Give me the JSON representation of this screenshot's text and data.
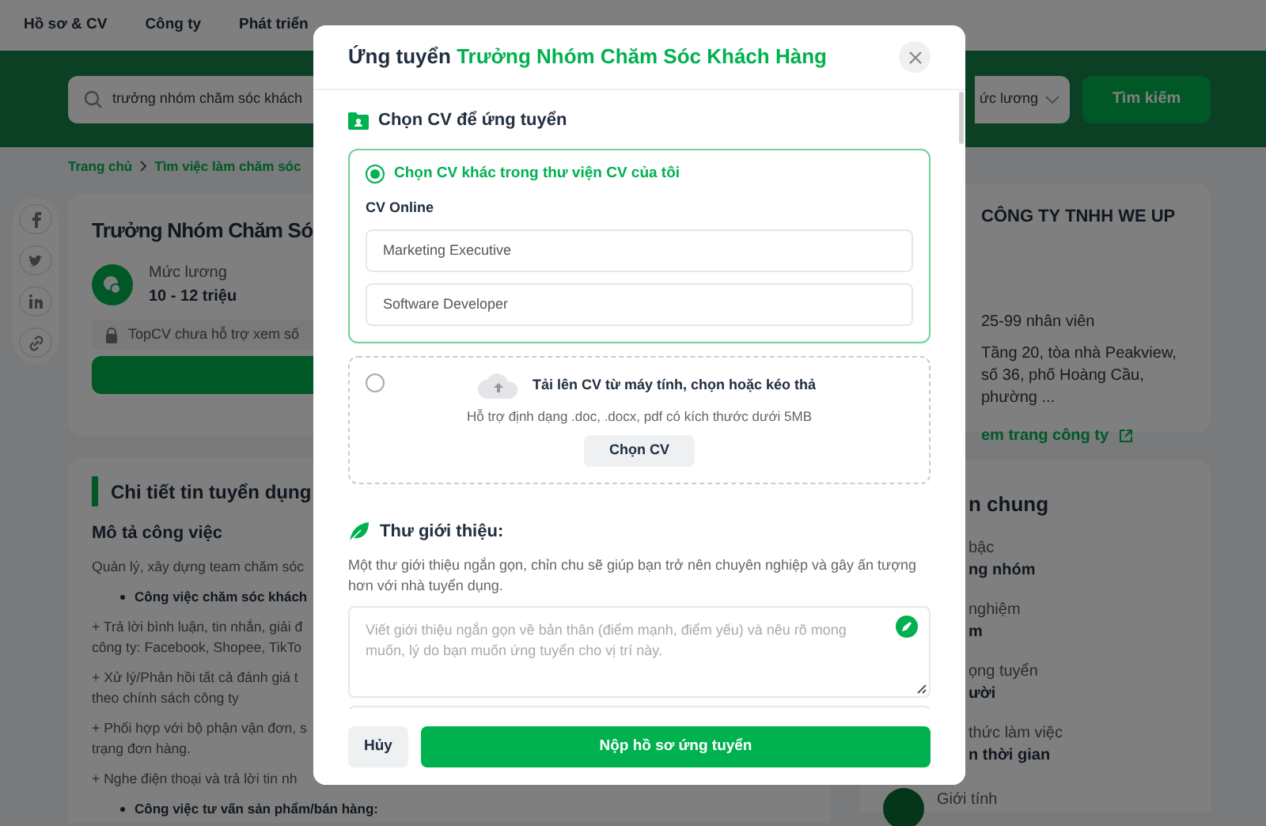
{
  "nav": {
    "items": [
      "Hồ sơ & CV",
      "Công ty",
      "Phát triển"
    ]
  },
  "search": {
    "value": "trưởng nhóm chăm sóc khách",
    "salary_filter": "ức lương",
    "button": "Tìm kiếm"
  },
  "breadcrumb": [
    "Trang chủ",
    "Tìm việc làm chăm sóc"
  ],
  "job": {
    "title": "Trưởng Nhóm Chăm Só",
    "salary_label": "Mức lương",
    "salary": "10 - 12 triệu",
    "notice": "TopCV chưa hỗ trợ xem số"
  },
  "details": {
    "title": "Chi tiết tin tuyển dụng",
    "section": "Mô tả công việc",
    "paragraphs": [
      {
        "kind": "text",
        "lines": [
          "Quản lý, xây dựng team chăm sóc"
        ]
      },
      {
        "kind": "bullet",
        "lines": [
          "Công việc chăm sóc khách"
        ]
      },
      {
        "kind": "text",
        "lines": [
          "+ Trả lời bình luận, tin nhắn, giải đ",
          "công ty: Facebook, Shopee, TikTo"
        ]
      },
      {
        "kind": "text",
        "lines": [
          "+ Xử lý/Phản hồi tất cả đánh giá t",
          "theo chính sách công ty"
        ]
      },
      {
        "kind": "text",
        "lines": [
          "+ Phối hợp với bộ phận vận đơn, s",
          "trạng đơn hàng."
        ]
      },
      {
        "kind": "text",
        "lines": [
          "+ Nghe điện thoại và trả lời tin nh"
        ]
      },
      {
        "kind": "bullet",
        "lines": [
          "Công việc tư vấn sản phẩm/bán hàng:"
        ]
      }
    ]
  },
  "company": {
    "name": "CÔNG TY TNHH WE UP",
    "size": "25-99 nhân viên",
    "address": "Tầng 20, tòa nhà Peakview, số 36, phố Hoàng Cầu, phường ...",
    "link": "em trang công ty"
  },
  "general": {
    "title": "n chung",
    "items": [
      {
        "kind": "partial",
        "label": "bậc",
        "value": "ng nhóm"
      },
      {
        "kind": "partial",
        "label": "nghiệm",
        "value": "m"
      },
      {
        "kind": "partial",
        "label": "ọng tuyển",
        "value": "ười"
      },
      {
        "kind": "partial",
        "label": "thức làm việc",
        "value": "n thời gian"
      },
      {
        "kind": "full",
        "label": "Giới tính"
      }
    ]
  },
  "dialog": {
    "title": "Ứng tuyển",
    "job_title": "Trưởng Nhóm Chăm Sóc Khách Hàng",
    "cv_heading": "Chọn CV để ứng tuyển",
    "options": [
      {
        "kind": "library",
        "selected": true,
        "label": "Chọn CV khác trong thư viện CV của tôi",
        "group": "CV Online",
        "cvs": [
          "Marketing Executive",
          "Software Developer"
        ]
      },
      {
        "kind": "upload",
        "selected": false,
        "label": "Tải lên CV từ máy tính, chọn hoặc kéo thả",
        "hint": "Hỗ trợ định dạng .doc, .docx, pdf có kích thước dưới 5MB",
        "button": "Chọn CV"
      }
    ],
    "letter_heading": "Thư giới thiệu:",
    "letter_description": "Một thư giới thiệu ngắn gọn, chỉn chu sẽ giúp bạn trở nên chuyên nghiệp và gây ấn tượng hơn với nhà tuyển dụng.",
    "letter_placeholder": "Viết giới thiệu ngắn gọn về bản thân (điểm mạnh, điểm yếu) và nêu rõ mong muốn, lý do bạn muốn ứng tuyển cho vị trí này.",
    "cancel": "Hủy",
    "submit": "Nộp hồ sơ ứng tuyển"
  }
}
